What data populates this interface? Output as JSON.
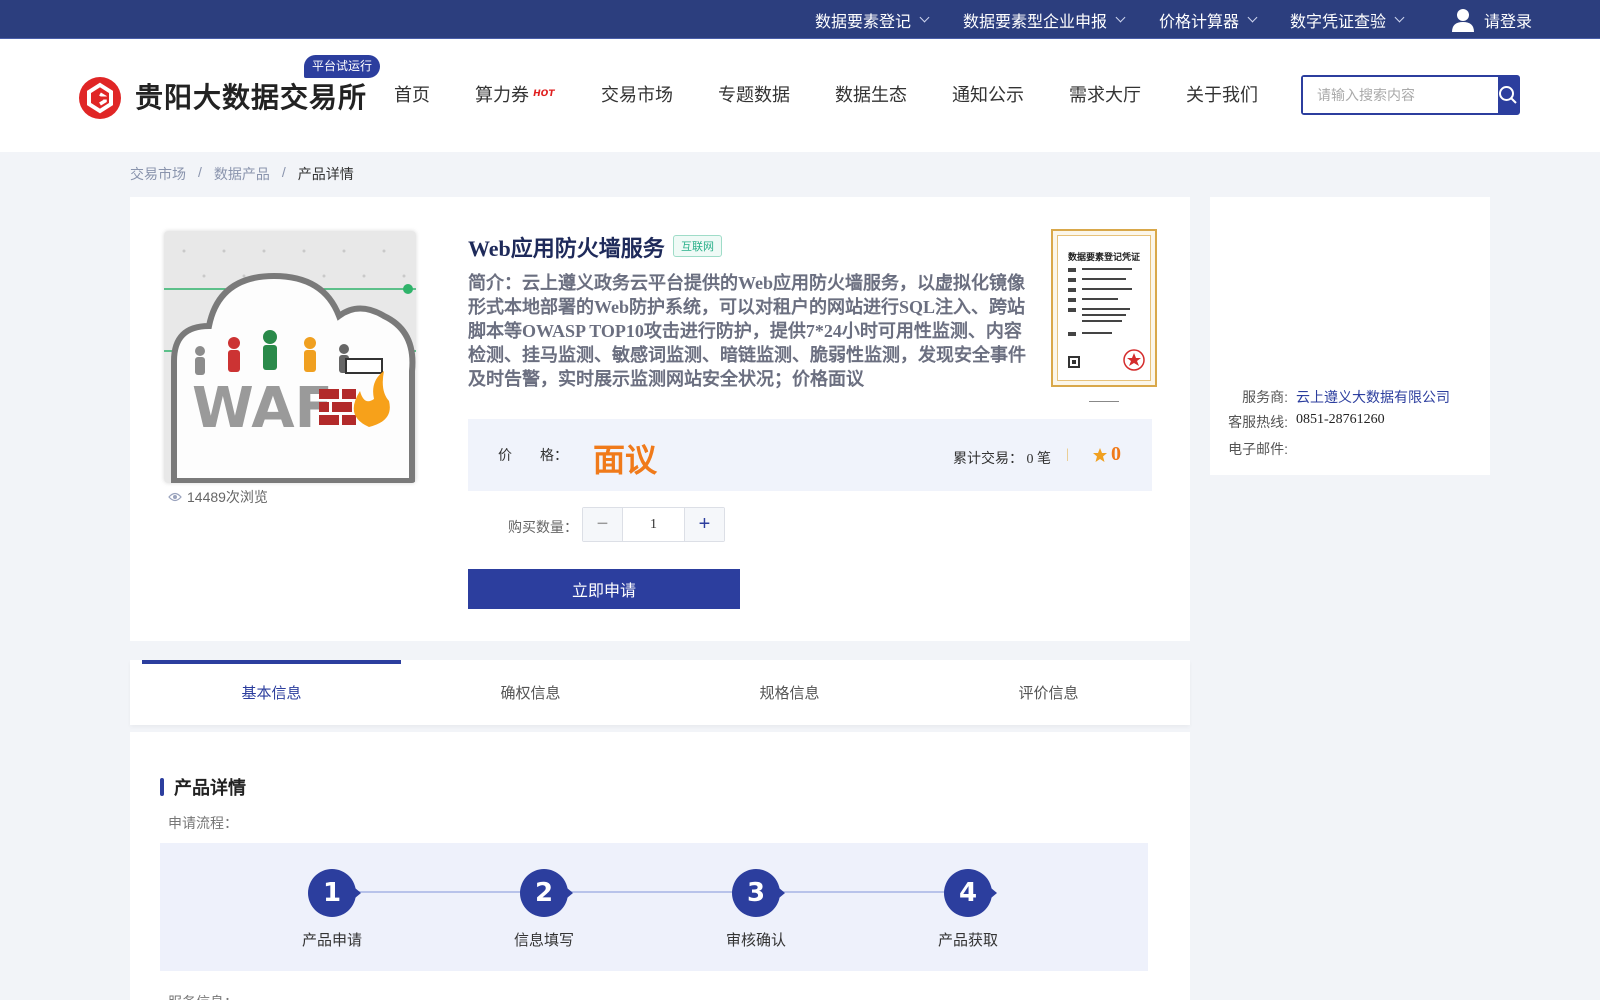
{
  "topbar": {
    "items": [
      {
        "label": "数据要素登记"
      },
      {
        "label": "数据要素型企业申报"
      },
      {
        "label": "价格计算器"
      },
      {
        "label": "数字凭证查验"
      }
    ],
    "login_label": "请登录"
  },
  "header": {
    "site_title": "贵阳大数据交易所",
    "trial_badge": "平台试运行",
    "nav": [
      {
        "label": "首页"
      },
      {
        "label": "算力券",
        "badge": "HOT"
      },
      {
        "label": "交易市场"
      },
      {
        "label": "专题数据"
      },
      {
        "label": "数据生态"
      },
      {
        "label": "通知公示"
      },
      {
        "label": "需求大厅"
      },
      {
        "label": "关于我们"
      }
    ],
    "search": {
      "placeholder": "请输入搜索内容",
      "value": ""
    }
  },
  "breadcrumb": {
    "items": [
      "交易市场",
      "数据产品",
      "产品详情"
    ],
    "separator": "/"
  },
  "product": {
    "title": "Web应用防火墙服务",
    "tag": "互联网",
    "description": "简介：云上遵义政务云平台提供的Web应用防火墙服务，以虚拟化镜像形式本地部署的Web防护系统，可以对租户的网站进行SQL注入、跨站脚本等OWASP TOP10攻击进行防护，提供7*24小时可用性监测、内容检测、挂马监测、敏感词监测、暗链监测、脆弱性监测，发现安全事件及时告警，实时展示监测网站安全状况；价格面议",
    "image_text": "WAF",
    "views": "14489次浏览",
    "certificate_title": "数据要素登记凭证",
    "price_label": "价　　格：",
    "price_value": "面议",
    "trades": "累计交易： 0 笔",
    "rating": "0",
    "qty_label": "购买数量：",
    "qty_value": "1",
    "apply_label": "立即申请"
  },
  "provider": {
    "service_label": "服务商:",
    "service_value": "云上遵义大数据有限公司",
    "hotline_label": "客服热线:",
    "hotline_value": "0851-28761260",
    "email_label": "电子邮件:",
    "email_value": ""
  },
  "tabs": [
    {
      "label": "基本信息",
      "active": true
    },
    {
      "label": "确权信息",
      "active": false
    },
    {
      "label": "规格信息",
      "active": false
    },
    {
      "label": "评价信息",
      "active": false
    }
  ],
  "details": {
    "title": "产品详情",
    "flow_label": "申请流程：",
    "steps": [
      {
        "num": "1",
        "label": "产品申请"
      },
      {
        "num": "2",
        "label": "信息填写"
      },
      {
        "num": "3",
        "label": "审核确认"
      },
      {
        "num": "4",
        "label": "产品获取"
      }
    ],
    "service_info_label": "服务信息："
  },
  "colors": {
    "primary": "#2c3e9e",
    "topbar": "#2c3e7e",
    "price": "#f07a1a",
    "tag_green": "#2ab08a"
  }
}
